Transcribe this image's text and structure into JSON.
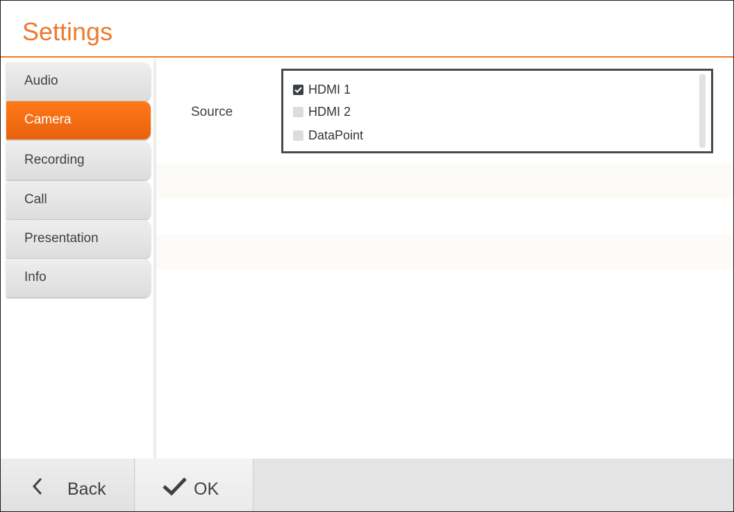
{
  "header": {
    "title": "Settings"
  },
  "sidebar": {
    "items": [
      {
        "label": "Audio",
        "active": false
      },
      {
        "label": "Camera",
        "active": true
      },
      {
        "label": "Recording",
        "active": false
      },
      {
        "label": "Call",
        "active": false
      },
      {
        "label": "Presentation",
        "active": false
      },
      {
        "label": "Info",
        "active": false
      }
    ]
  },
  "camera": {
    "source_label": "Source",
    "options": [
      {
        "label": "HDMI 1",
        "checked": true
      },
      {
        "label": "HDMI 2",
        "checked": false
      },
      {
        "label": "DataPoint",
        "checked": false
      }
    ]
  },
  "footer": {
    "back_label": "Back",
    "ok_label": "OK"
  },
  "colors": {
    "accent": "#ee7a2c",
    "active_tab": "#f26b12",
    "checkbox_checked": "#3a3f44"
  },
  "icons": {
    "back": "chevron-left-icon",
    "ok": "checkmark-icon",
    "checked_box": "check-icon"
  }
}
